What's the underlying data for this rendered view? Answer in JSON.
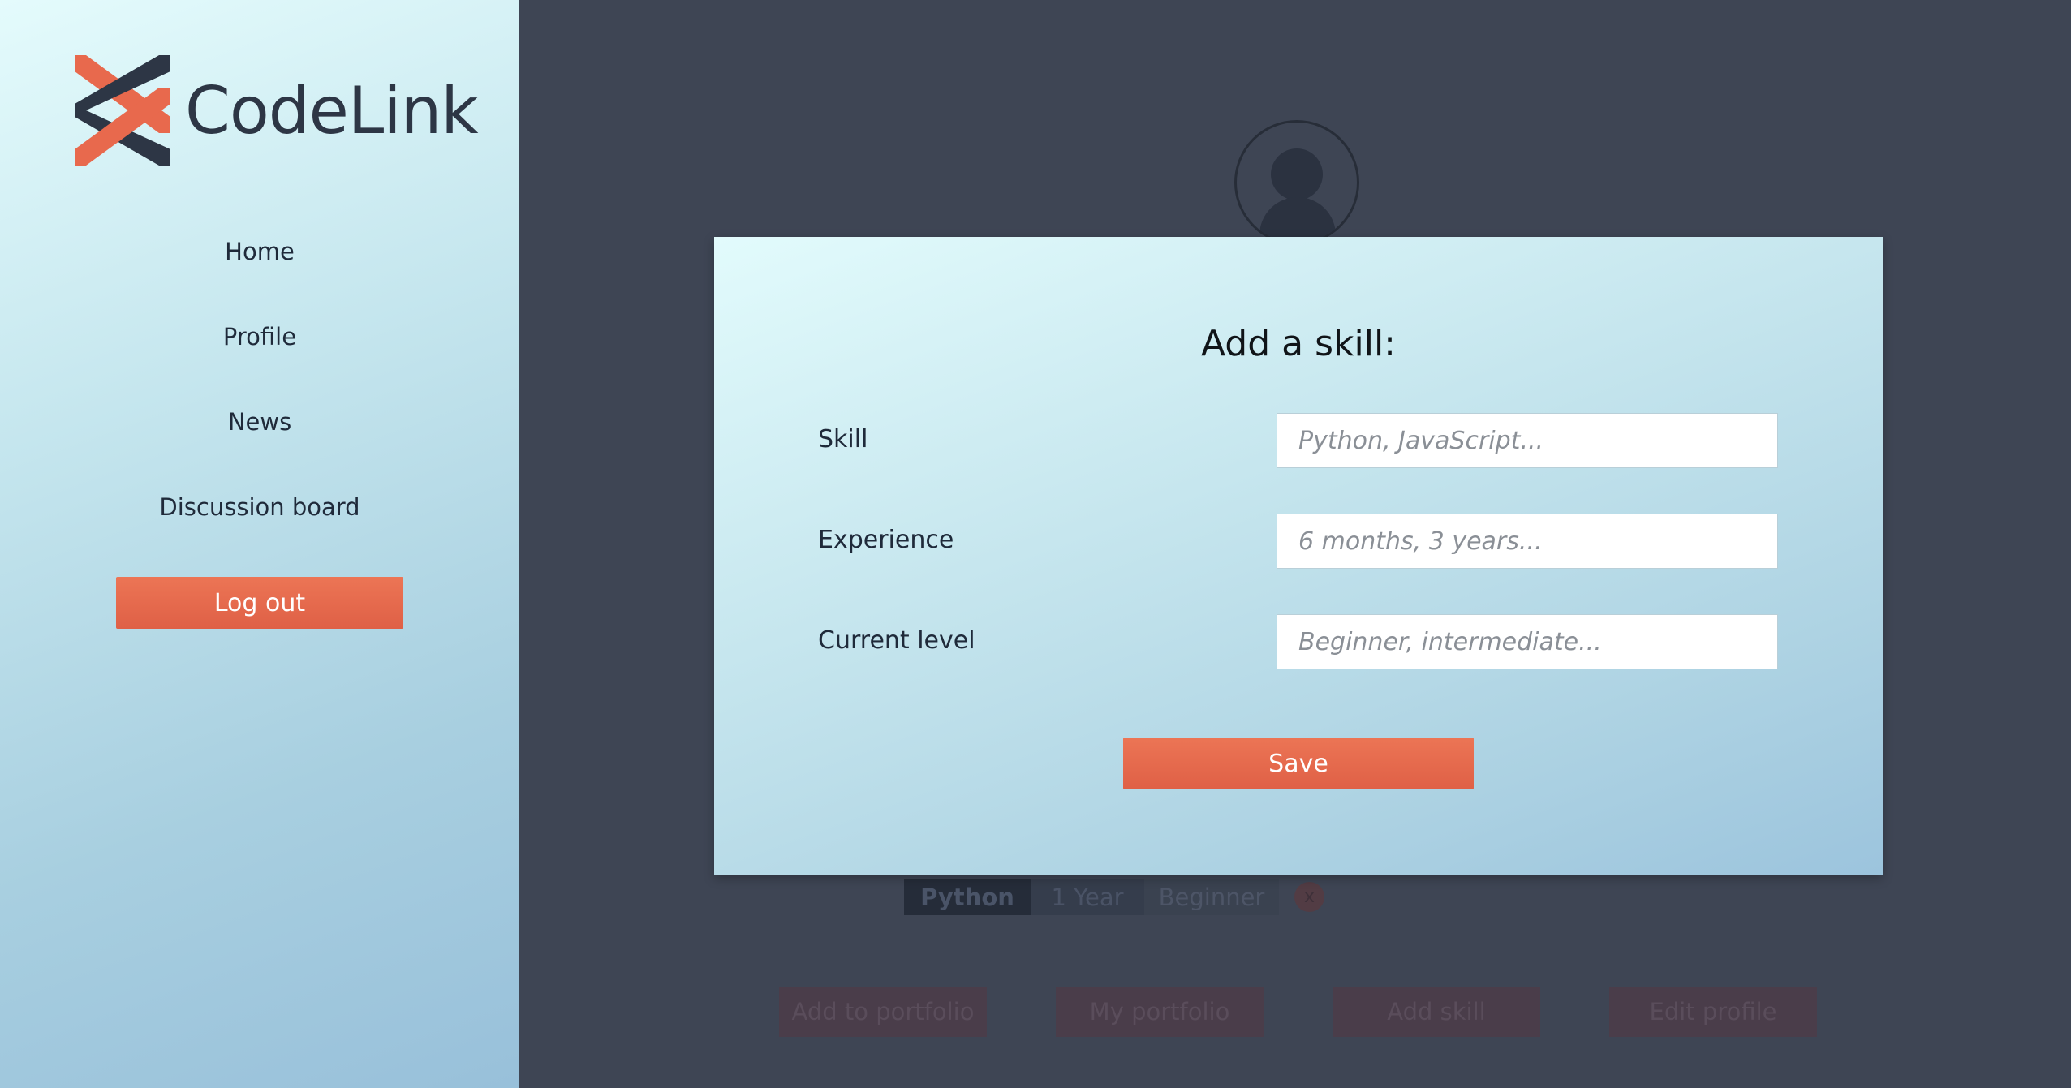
{
  "brand": {
    "name": "CodeLink",
    "colors": {
      "accent": "#e8694d",
      "dark": "#2d3645"
    }
  },
  "sidebar": {
    "items": [
      {
        "label": "Home"
      },
      {
        "label": "Profile"
      },
      {
        "label": "News"
      },
      {
        "label": "Discussion board"
      }
    ],
    "logout_label": "Log out"
  },
  "profile": {
    "avatar_icon": "user-avatar-icon",
    "skills": [
      {
        "name": "Python",
        "experience": "1 Year",
        "level": "Beginner",
        "remove_label": "x"
      }
    ],
    "actions": [
      {
        "label": "Add to portfolio"
      },
      {
        "label": "My portfolio"
      },
      {
        "label": "Add skill"
      },
      {
        "label": "Edit profile"
      }
    ]
  },
  "modal": {
    "title": "Add a skill:",
    "fields": [
      {
        "label": "Skill",
        "value": "",
        "placeholder": "Python, JavaScript..."
      },
      {
        "label": "Experience",
        "value": "",
        "placeholder": "6 months, 3 years..."
      },
      {
        "label": "Current level",
        "value": "",
        "placeholder": "Beginner, intermediate..."
      }
    ],
    "save_label": "Save"
  }
}
